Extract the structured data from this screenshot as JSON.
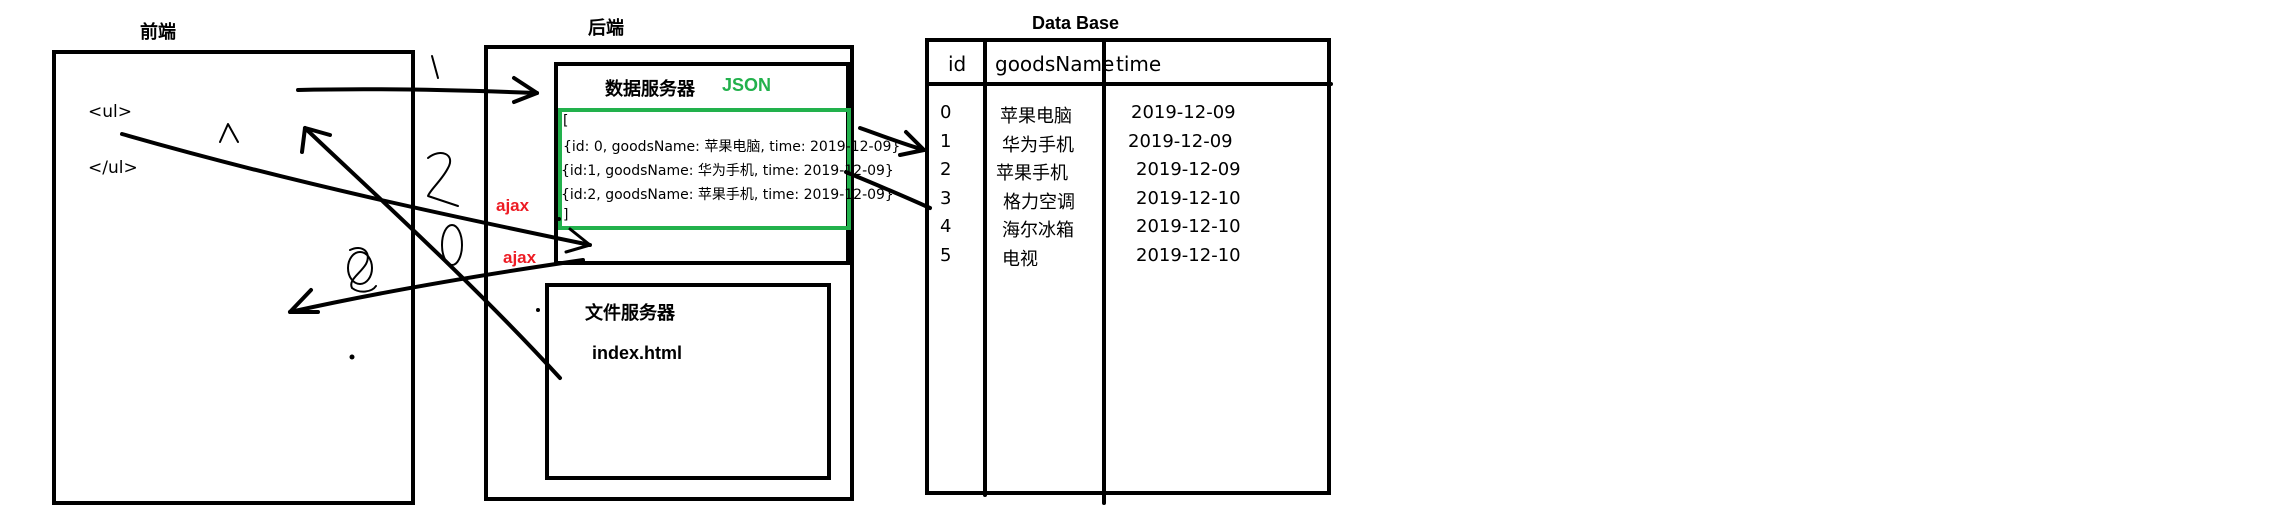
{
  "frontend": {
    "title": "前端",
    "ul_open": "<ul>",
    "ul_close": "</ul>"
  },
  "backend": {
    "title": "后端",
    "data_server": {
      "title": "数据服务器",
      "format_label": "JSON",
      "json_lines": [
        "[",
        "{id: 0, goodsName: 苹果电脑, time: 2019-12-09}",
        "{id:1, goodsName: 华为手机, time: 2019-12-09}",
        "{id:2, goodsName: 苹果手机, time: 2019-12-09}",
        "]"
      ]
    },
    "file_server": {
      "title": "文件服务器",
      "file": "index.html"
    }
  },
  "ajax_labels": [
    "ajax",
    "ajax"
  ],
  "database": {
    "title": "Data Base",
    "columns": [
      "id",
      "goodsName",
      "time"
    ],
    "rows": [
      [
        "0",
        "苹果电脑",
        "2019-12-09"
      ],
      [
        "1",
        "华为手机",
        "2019-12-09"
      ],
      [
        "2",
        "苹果手机",
        "2019-12-09"
      ],
      [
        "3",
        "格力空调",
        "2019-12-10"
      ],
      [
        "4",
        "海尔冰箱",
        "2019-12-10"
      ],
      [
        "5",
        "电视",
        "2019-12-10"
      ]
    ]
  },
  "colors": {
    "ink": "#000000",
    "json_box": "#22b14c",
    "ajax": "#ed1c24"
  }
}
